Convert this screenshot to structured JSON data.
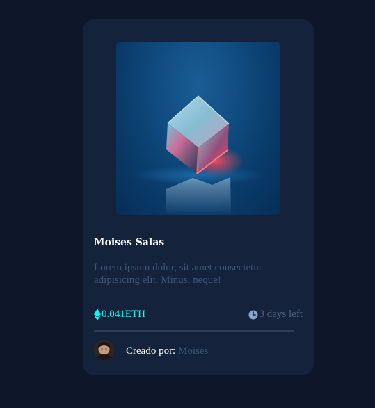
{
  "card": {
    "title": "Moises Salas",
    "description": "Lorem ipsum dolor, sit amet consectetur adipisicing elit. Minus, neque!",
    "price": "0.041ETH",
    "time_left": "3 days left",
    "creator_label": "Creado por:",
    "creator_name": "Moises"
  },
  "icons": {
    "currency": "ethereum-icon",
    "time": "clock-icon"
  },
  "colors": {
    "background": "#0e172a",
    "card": "#15223b",
    "accent_cyan": "#00fff8",
    "muted_text": "#3e5679",
    "divider": "#2e3d58"
  }
}
